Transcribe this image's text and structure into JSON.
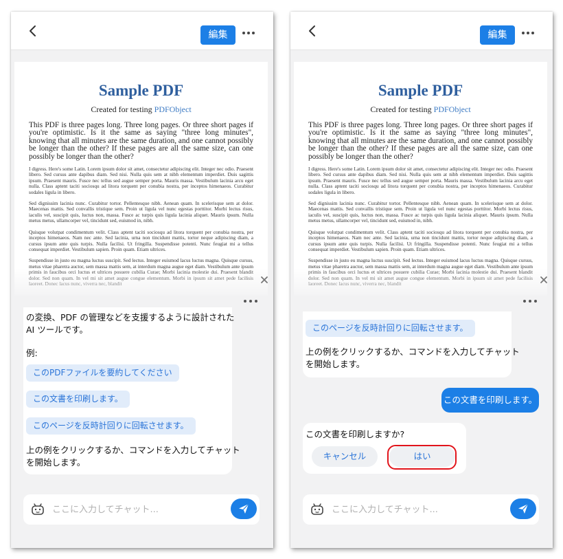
{
  "appbar": {
    "edit_label": "編集"
  },
  "pdf": {
    "title": "Sample PDF",
    "subtitle_prefix": "Created for testing ",
    "subtitle_link": "PDFObject",
    "lead": "This PDF is three pages long. Three long pages. Or three short pages if you're optimistic. Is it the same as saying \"three long minutes\", knowing that all minutes are the same duration, and one cannot possibly be longer than the other? If these pages are all the same size, can one possibly be longer than the other?",
    "paragraphs": [
      "I digress. Here's some Latin. Lorem ipsum dolor sit amet, consectetur adipiscing elit. Integer nec odio. Praesent libero. Sed cursus ante dapibus diam. Sed nisi. Nulla quis sem at nibh elementum imperdiet. Duis sagittis ipsum. Praesent mauris. Fusce nec tellus sed augue semper porta. Mauris massa. Vestibulum lacinia arcu eget nulla. Class aptent taciti sociosqu ad litora torquent per conubia nostra, per inceptos himenaeos. Curabitur sodales ligula in libero.",
      "Sed dignissim lacinia nunc. Curabitur tortor. Pellentesque nibh. Aenean quam. In scelerisque sem at dolor. Maecenas mattis. Sed convallis tristique sem. Proin ut ligula vel nunc egestas porttitor. Morbi lectus risus, iaculis vel, suscipit quis, luctus non, massa. Fusce ac turpis quis ligula lacinia aliquet. Mauris ipsum. Nulla metus metus, ullamcorper vel, tincidunt sed, euismod in, nibh.",
      "Quisque volutpat condimentum velit. Class aptent taciti sociosqu ad litora torquent per conubia nostra, per inceptos himenaeos. Nam nec ante. Sed lacinia, urna non tincidunt mattis, tortor neque adipiscing diam, a cursus ipsum ante quis turpis. Nulla facilisi. Ut fringilla. Suspendisse potenti. Nunc feugiat mi a tellus consequat imperdiet. Vestibulum sapien. Proin quam. Etiam ultrices.",
      "Suspendisse in justo eu magna luctus suscipit. Sed lectus. Integer euismod lacus luctus magna. Quisque cursus, metus vitae pharetra auctor, sem massa mattis sem, at interdum magna augue eget diam. Vestibulum ante ipsum primis in faucibus orci luctus et ultrices posuere cubilia Curae; Morbi lacinia molestie dui. Praesent blandit dolor. Sed non quam. In vel mi sit amet augue congue elementum. Morbi in ipsum sit amet pede facilisis laoreet. Donec lacus nunc, viverra nec, blandit"
    ]
  },
  "left_chat": {
    "intro_line1": "の変換、PDF の管理などを支援するように設計された",
    "intro_line2": "AI ツールです。",
    "example_label": "例:",
    "examples": [
      "このPDFファイルを要約してください",
      "この文書を印刷します。",
      "このページを反時計回りに回転させます。"
    ],
    "outro_line1": "上の例をクリックするか、コマンドを入力してチャット",
    "outro_line2": "を開始します。"
  },
  "right_chat": {
    "example": "このページを反時計回りに回転させます。",
    "outro_line1": "上の例をクリックするか、コマンドを入力してチャット",
    "outro_line2": "を開始します。",
    "user_message": "この文書を印刷します。",
    "confirm_question": "この文書を印刷しますか?",
    "cancel_label": "キャンセル",
    "yes_label": "はい"
  },
  "input": {
    "placeholder": "ここに入力してチャット..."
  },
  "colors": {
    "accent": "#1c7fe6",
    "chip_bg": "#e1ecfa",
    "highlight": "#e1141b"
  },
  "icons": {
    "back": "chevron-left-icon",
    "more": "more-horizontal-icon",
    "close": "close-icon",
    "bot": "bot-icon",
    "send": "send-icon"
  }
}
